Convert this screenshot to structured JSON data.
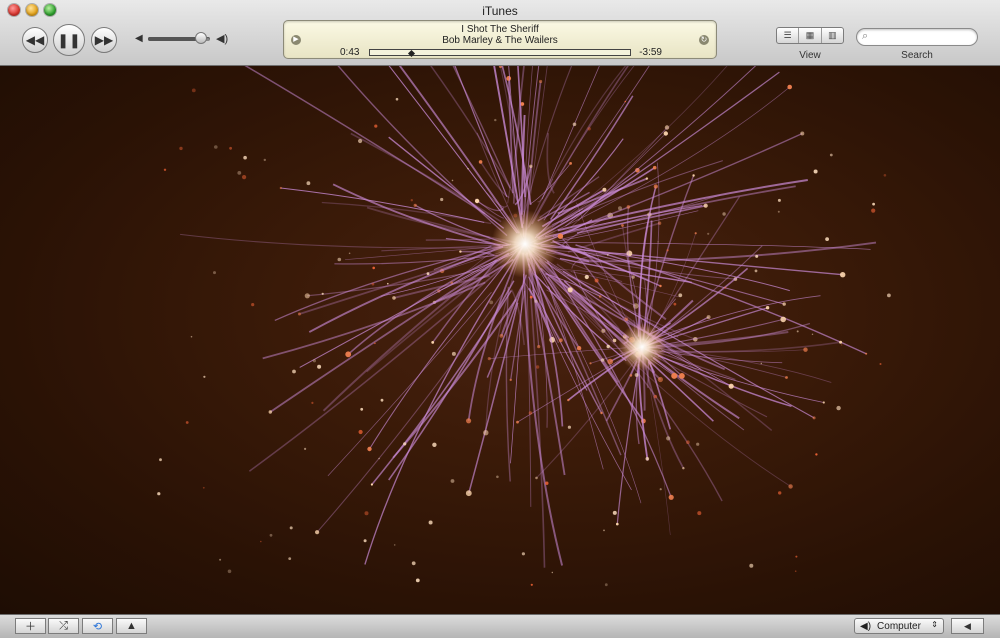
{
  "window": {
    "title": "iTunes"
  },
  "transport": {
    "prev_icon": "rewind-icon",
    "play_pause_icon": "pause-icon",
    "next_icon": "fast-forward-icon",
    "volume_level": 0.85
  },
  "now_playing": {
    "song": "I Shot The Sheriff",
    "artist": "Bob Marley & The Wailers",
    "elapsed": "0:43",
    "remaining": "-3:59",
    "progress": 0.15
  },
  "view": {
    "label": "View",
    "buttons": [
      "list-view-icon",
      "grid-view-icon",
      "cover-flow-icon"
    ]
  },
  "search": {
    "label": "Search",
    "placeholder": "",
    "value": ""
  },
  "bottom": {
    "add_icon": "plus-icon",
    "shuffle_icon": "shuffle-icon",
    "repeat_icon": "repeat-icon",
    "artwork_icon": "show-artwork-icon",
    "speaker_label": "Computer"
  },
  "colors": {
    "accent": "#2a74d9",
    "lcd": "#f4f1d6",
    "visualizer_bg": "#3a1a08",
    "particle": "#c98ad6"
  }
}
